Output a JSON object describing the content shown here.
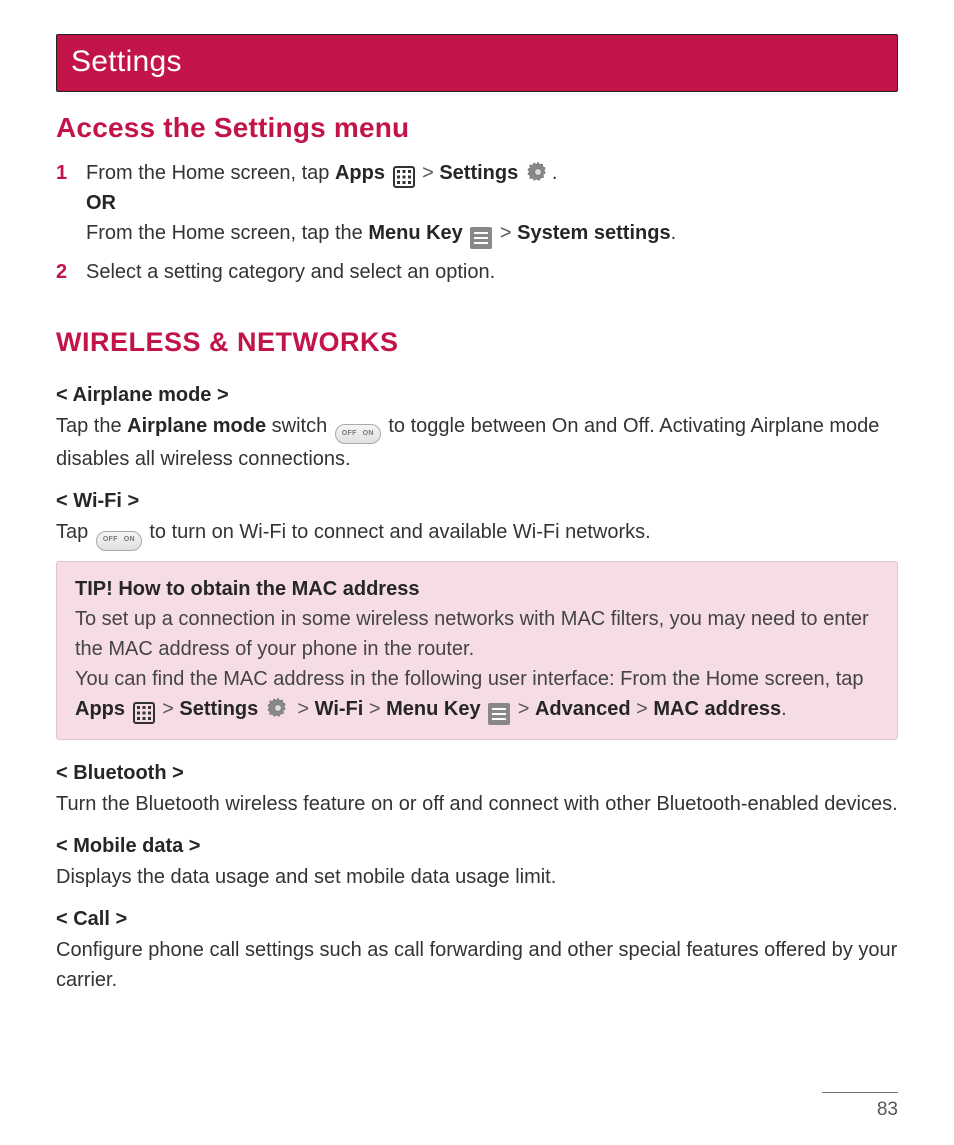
{
  "title_bar": "Settings",
  "h_access": "Access the Settings menu",
  "step1": {
    "a": "From the Home screen, tap ",
    "apps": "Apps",
    "gt1": " > ",
    "settings": "Settings",
    "period": ".",
    "or": "OR",
    "b": "From the Home screen, tap the ",
    "menu_key": "Menu Key",
    "gt2": " > ",
    "sys_settings": "System settings",
    "period2": "."
  },
  "step2": "Select a setting category and select an option.",
  "h_wireless": "WIRELESS & NETWORKS",
  "airplane": {
    "head": "< Airplane mode >",
    "t1": "Tap the ",
    "bold": "Airplane mode",
    "t2": " switch ",
    "t3": " to toggle between On and Off. Activating Airplane mode disables all wireless connections."
  },
  "wifi": {
    "head": "< Wi-Fi >",
    "t1": "Tap ",
    "t2": " to turn on Wi-Fi to connect and available Wi-Fi networks."
  },
  "tip": {
    "head": "TIP! How to obtain the MAC address",
    "l1": "To set up a connection in some wireless networks with MAC filters, you may need to enter the MAC address of your phone in the router.",
    "l2a": "You can find the MAC address in the following user interface: From the Home screen, tap ",
    "apps": "Apps",
    "gt1": " > ",
    "settings": "Settings",
    "gt2": " > ",
    "wifi": "Wi-Fi",
    "gt3": " > ",
    "menu_key": "Menu Key",
    "gt4": " > ",
    "advanced": "Advanced",
    "gt5": " > ",
    "mac": "MAC address",
    "period": "."
  },
  "bluetooth": {
    "head": "< Bluetooth >",
    "body": "Turn the Bluetooth wireless feature on or off and connect with other Bluetooth-enabled devices."
  },
  "mobile": {
    "head": "< Mobile data >",
    "body": "Displays the data usage and set mobile data usage limit."
  },
  "call": {
    "head": "< Call >",
    "body": "Configure phone call settings such as call forwarding and other special features offered by your carrier."
  },
  "toggle": {
    "off": "OFF",
    "on": "ON"
  },
  "page_number": "83"
}
